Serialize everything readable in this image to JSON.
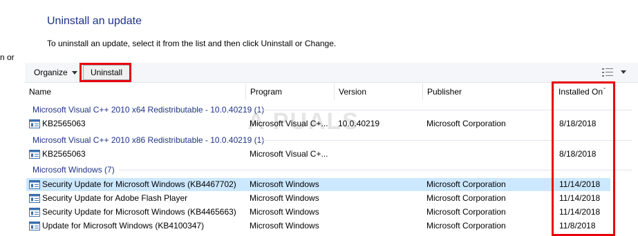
{
  "side_clip_text": "n or",
  "page": {
    "title": "Uninstall an update",
    "description": "To uninstall an update, select it from the list and then click Uninstall or Change."
  },
  "toolbar": {
    "organize_label": "Organize",
    "uninstall_label": "Uninstall",
    "view_icon": "view-details-icon"
  },
  "columns": {
    "name": "Name",
    "program": "Program",
    "version": "Version",
    "publisher": "Publisher",
    "installed_on": "Installed On"
  },
  "watermark": "A  PUALS",
  "groups": [
    {
      "title": "Microsoft Visual C++ 2010  x64 Redistributable - 10.0.40219 (1)",
      "rows": [
        {
          "name": "KB2565063",
          "program": "Microsoft Visual C+...",
          "version": "10.0.40219",
          "publisher": "Microsoft Corporation",
          "installed_on": "8/18/2018"
        }
      ]
    },
    {
      "title": "Microsoft Visual C++ 2010  x86 Redistributable - 10.0.40219 (1)",
      "rows": [
        {
          "name": "KB2565063",
          "program": "Microsoft Visual C+...",
          "version": "",
          "publisher": "",
          "installed_on": "8/18/2018"
        }
      ]
    },
    {
      "title": "Microsoft Windows (7)",
      "rows": [
        {
          "name": "Security Update for Microsoft Windows (KB4467702)",
          "program": "Microsoft Windows",
          "version": "",
          "publisher": "Microsoft Corporation",
          "installed_on": "11/14/2018",
          "selected": true
        },
        {
          "name": "Security Update for Adobe Flash Player",
          "program": "Microsoft Windows",
          "version": "",
          "publisher": "Microsoft Corporation",
          "installed_on": "11/14/2018"
        },
        {
          "name": "Security Update for Microsoft Windows (KB4465663)",
          "program": "Microsoft Windows",
          "version": "",
          "publisher": "Microsoft Corporation",
          "installed_on": "11/14/2018"
        },
        {
          "name": "Update for Microsoft Windows (KB4100347)",
          "program": "Microsoft Windows",
          "version": "",
          "publisher": "Microsoft Corporation",
          "installed_on": "11/8/2018"
        }
      ]
    }
  ],
  "colors": {
    "title_blue": "#1e3287",
    "selection": "#cce8ff",
    "highlight_red": "#e8000d"
  }
}
